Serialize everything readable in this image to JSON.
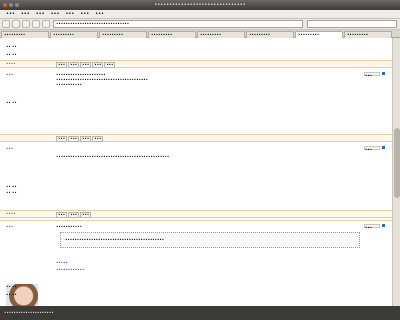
{
  "window": {
    "title": "•••••••••••••••••••••••••••••••"
  },
  "menu": [
    "•••",
    "•••",
    "•••",
    "•••",
    "•••",
    "•••",
    "•••"
  ],
  "nav": {
    "url": "•••••••••••••••••••••••••••••••"
  },
  "tabs": [
    "•••••••••",
    "•••••••••",
    "•••••••••",
    "•••••••••",
    "•••••••••",
    "•••••••••",
    "•••••••••",
    "•••••••••"
  ],
  "posts": [
    {
      "author": "•••",
      "meta": [
        "•• ••",
        "•• ••",
        "•• ••"
      ],
      "body": [
        "•••••••••••••••••••••",
        "•••••••••••••••••••••••••••••••••••••••",
        "•••••••••••"
      ],
      "tag": "••••",
      "edit": "•••",
      "footer": [
        "•••",
        "•••",
        "•••",
        "•••",
        "•••",
        "•••"
      ]
    },
    {
      "author": "•••",
      "meta": [
        "•• ••",
        "•• ••",
        "•• ••"
      ],
      "body": [
        "••••••••••••••••••••••••••••••••••••••••••••••••"
      ],
      "tag": "••••",
      "edit": "•••",
      "footer": [
        "•••",
        "•••",
        "•••"
      ]
    },
    {
      "author": "•••",
      "meta": [
        "•• ••",
        "•• ••"
      ],
      "body": [
        "•••••••••••"
      ],
      "quote": "••••••••••••••••••••••••••••••••••••••••••",
      "links": [
        "•••••",
        "••••••••••••"
      ],
      "tag": "••••",
      "edit": "•••"
    }
  ],
  "status": {
    "text": "•••••••••••••••••••••"
  }
}
